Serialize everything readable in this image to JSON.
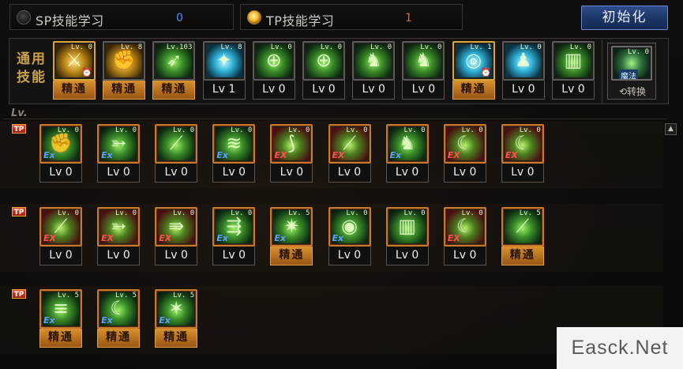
{
  "header": {
    "sp_label": "SP技能学习",
    "sp_value": "0",
    "tp_label": "TP技能学习",
    "tp_value": "1",
    "init_button": "初始化"
  },
  "general": {
    "label_line1": "通用",
    "label_line2": "技能",
    "skills": [
      {
        "level": "Lv. 0",
        "plate": "精通",
        "art": "y",
        "symbol": "⚔",
        "frame": "gold",
        "badge": "clock"
      },
      {
        "level": "Lv. 8",
        "plate": "精通",
        "art": "y",
        "symbol": "✊",
        "frame": "",
        "badge": ""
      },
      {
        "level": "Lv.103",
        "plate": "精通",
        "art": "g",
        "symbol": "➶",
        "frame": "",
        "badge": ""
      },
      {
        "level": "Lv. 8",
        "plate": "Lv 1",
        "art": "b",
        "symbol": "✦",
        "frame": "",
        "badge": ""
      },
      {
        "level": "Lv. 0",
        "plate": "Lv 0",
        "art": "g",
        "symbol": "⊕",
        "frame": "",
        "badge": ""
      },
      {
        "level": "Lv. 0",
        "plate": "Lv 0",
        "art": "g",
        "symbol": "⊕",
        "frame": "",
        "badge": ""
      },
      {
        "level": "Lv. 0",
        "plate": "Lv 0",
        "art": "g",
        "symbol": "♞",
        "frame": "",
        "badge": ""
      },
      {
        "level": "Lv. 0",
        "plate": "Lv 0",
        "art": "g",
        "symbol": "♞",
        "frame": "",
        "badge": ""
      },
      {
        "level": "Lv. 1",
        "plate": "精通",
        "art": "b",
        "symbol": "◎",
        "frame": "gold",
        "badge": "clock"
      },
      {
        "level": "Lv. 0",
        "plate": "Lv 0",
        "art": "b",
        "symbol": "♟",
        "frame": "",
        "badge": ""
      },
      {
        "level": "Lv. 0",
        "plate": "Lv 0",
        "art": "g",
        "symbol": "▥",
        "frame": "",
        "badge": ""
      }
    ],
    "mana": {
      "level": "Lv. 0",
      "tag": "魔法",
      "switch_label": "⟲转换"
    }
  },
  "tp_section": {
    "lv_label": "Lv.",
    "tp_tag": "TP",
    "scroll_up": "▲",
    "rows": [
      [
        {
          "level": "Lv. 0",
          "plate": "Lv 0",
          "art": "g",
          "symbol": "✊",
          "ex": "Ex"
        },
        {
          "level": "Lv. 0",
          "plate": "Lv 0",
          "art": "g",
          "symbol": "➳",
          "ex": "Ex"
        },
        {
          "level": "Lv. 0",
          "plate": "Lv 0",
          "art": "g",
          "symbol": "⟋",
          "ex": ""
        },
        {
          "level": "Lv. 0",
          "plate": "Lv 0",
          "art": "g",
          "symbol": "≋",
          "ex": "Ex"
        },
        {
          "level": "Lv. 0",
          "plate": "Lv 0",
          "art": "r",
          "symbol": "⟆",
          "ex": "EX"
        },
        {
          "level": "Lv. 0",
          "plate": "Lv 0",
          "art": "r",
          "symbol": "⟋",
          "ex": "EX"
        },
        {
          "level": "Lv. 0",
          "plate": "Lv 0",
          "art": "g",
          "symbol": "♞",
          "ex": "Ex"
        },
        {
          "level": "Lv. 0",
          "plate": "Lv 0",
          "art": "r",
          "symbol": "☾",
          "ex": "EX"
        },
        {
          "level": "Lv. 0",
          "plate": "Lv 0",
          "art": "r",
          "symbol": "☾",
          "ex": "EX"
        }
      ],
      [
        {
          "level": "Lv. 0",
          "plate": "Lv 0",
          "art": "r",
          "symbol": "⟋",
          "ex": "EX"
        },
        {
          "level": "Lv. 0",
          "plate": "Lv 0",
          "art": "r",
          "symbol": "➳",
          "ex": "EX"
        },
        {
          "level": "Lv. 0",
          "plate": "Lv 0",
          "art": "r",
          "symbol": "⇛",
          "ex": "EX"
        },
        {
          "level": "Lv. 0",
          "plate": "Lv 0",
          "art": "g",
          "symbol": "⇶",
          "ex": "Ex"
        },
        {
          "level": "Lv. 5",
          "plate": "精通",
          "art": "g",
          "symbol": "✷",
          "ex": "Ex"
        },
        {
          "level": "Lv. 0",
          "plate": "Lv 0",
          "art": "g",
          "symbol": "◉",
          "ex": "Ex"
        },
        {
          "level": "Lv. 0",
          "plate": "Lv 0",
          "art": "g",
          "symbol": "▥",
          "ex": ""
        },
        {
          "level": "Lv. 0",
          "plate": "Lv 0",
          "art": "r",
          "symbol": "☾",
          "ex": "EX"
        },
        {
          "level": "Lv. 5",
          "plate": "精通",
          "art": "g",
          "symbol": "⟋",
          "ex": ""
        }
      ],
      [
        {
          "level": "Lv. 5",
          "plate": "精通",
          "art": "g",
          "symbol": "≡",
          "ex": "Ex"
        },
        {
          "level": "Lv. 5",
          "plate": "精通",
          "art": "g",
          "symbol": "☾",
          "ex": "Ex"
        },
        {
          "level": "Lv. 5",
          "plate": "精通",
          "art": "g",
          "symbol": "✶",
          "ex": "Ex"
        }
      ]
    ]
  },
  "watermark": "Easck.Net"
}
